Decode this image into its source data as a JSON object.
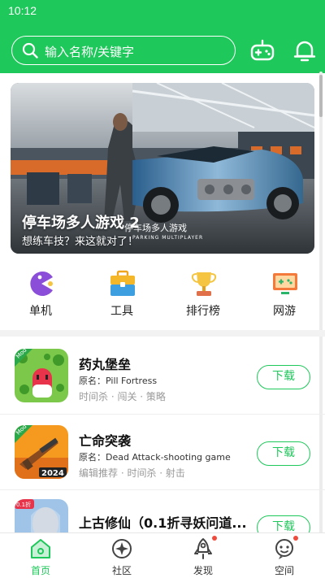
{
  "status_bar": {
    "time": "10:12"
  },
  "search": {
    "placeholder": "输入名称/关键字"
  },
  "header_icons": [
    "gamepad-icon",
    "bell-icon"
  ],
  "banner": {
    "title": "停车场多人游戏 2",
    "subtitle": "想练车技？来这就对了！",
    "overlay_text": "停车场多人游戏",
    "overlay_sub": "PARKING MULTIPLAYER"
  },
  "categories": [
    {
      "label": "单机",
      "icon": "pacman-icon"
    },
    {
      "label": "工具",
      "icon": "toolbox-icon"
    },
    {
      "label": "排行榜",
      "icon": "trophy-icon"
    },
    {
      "label": "网游",
      "icon": "monitor-game-icon"
    }
  ],
  "games": [
    {
      "name": "药丸堡垒",
      "original": "原名：Pill Fortress",
      "tags": "时间杀 · 闯关 · 策略",
      "badge": "Mod",
      "button": "下载"
    },
    {
      "name": "亡命突袭",
      "original": "原名：Dead Attack-shooting game",
      "tags": "编辑推荐 · 时间杀 · 射击",
      "badge": "Mod",
      "badge2": "2024",
      "button": "下载"
    },
    {
      "name": "上古修仙（0.1折寻妖问道...",
      "original": "",
      "tags": "",
      "badge": "0.1折",
      "button": "下载"
    }
  ],
  "tabbar": [
    {
      "label": "首页",
      "icon": "home-icon",
      "active": true
    },
    {
      "label": "社区",
      "icon": "community-icon",
      "active": false
    },
    {
      "label": "发现",
      "icon": "rocket-icon",
      "active": false
    },
    {
      "label": "空间",
      "icon": "profile-icon",
      "active": false
    }
  ],
  "colors": {
    "brand": "#1ec85a",
    "dot": "#f04a3c"
  }
}
